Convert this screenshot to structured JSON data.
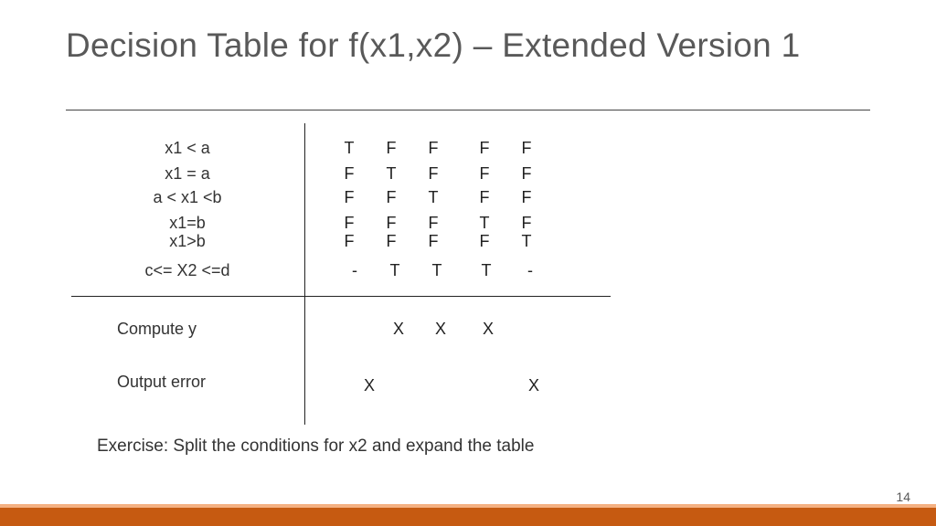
{
  "title": "Decision Table for f(x1,x2) – Extended Version 1",
  "conditions": [
    "x1 < a",
    "x1 = a",
    "a < x1 <b",
    "x1=b",
    "x1>b",
    "c<= X2 <=d"
  ],
  "matrix": [
    [
      "T",
      "F",
      "F",
      "F",
      "F"
    ],
    [
      "F",
      "T",
      "F",
      "F",
      "F"
    ],
    [
      "F",
      "F",
      "T",
      "F",
      "F"
    ],
    [
      "F",
      "F",
      "F",
      "T",
      "F"
    ],
    [
      "F",
      "F",
      "F",
      "F",
      "T"
    ],
    [
      "-",
      "T",
      "T",
      "T",
      "-"
    ]
  ],
  "actions": [
    {
      "label": "Compute y",
      "marks": [
        "",
        "X",
        "X",
        "X",
        ""
      ]
    },
    {
      "label": "Output error",
      "marks": [
        "X",
        "",
        "",
        "",
        "X"
      ]
    }
  ],
  "exercise": "Exercise: Split the conditions for x2 and expand the table",
  "page": "14",
  "chart_data": {
    "type": "table",
    "title": "Decision Table for f(x1,x2) – Extended Version 1",
    "conditions": [
      "x1 < a",
      "x1 = a",
      "a < x1 < b",
      "x1 = b",
      "x1 > b",
      "c <= X2 <= d"
    ],
    "rules": [
      {
        "x1<a": "T",
        "x1=a": "F",
        "a<x1<b": "F",
        "x1=b": "F",
        "x1>b": "F",
        "c<=X2<=d": "-",
        "Compute y": "",
        "Output error": "X"
      },
      {
        "x1<a": "F",
        "x1=a": "T",
        "a<x1<b": "F",
        "x1=b": "F",
        "x1>b": "F",
        "c<=X2<=d": "T",
        "Compute y": "X",
        "Output error": ""
      },
      {
        "x1<a": "F",
        "x1=a": "F",
        "a<x1<b": "T",
        "x1=b": "F",
        "x1>b": "F",
        "c<=X2<=d": "T",
        "Compute y": "X",
        "Output error": ""
      },
      {
        "x1<a": "F",
        "x1=a": "F",
        "a<x1<b": "F",
        "x1=b": "T",
        "x1>b": "F",
        "c<=X2<=d": "T",
        "Compute y": "X",
        "Output error": ""
      },
      {
        "x1<a": "F",
        "x1=a": "F",
        "a<x1<b": "F",
        "x1=b": "F",
        "x1>b": "T",
        "c<=X2<=d": "-",
        "Compute y": "",
        "Output error": "X"
      }
    ]
  }
}
